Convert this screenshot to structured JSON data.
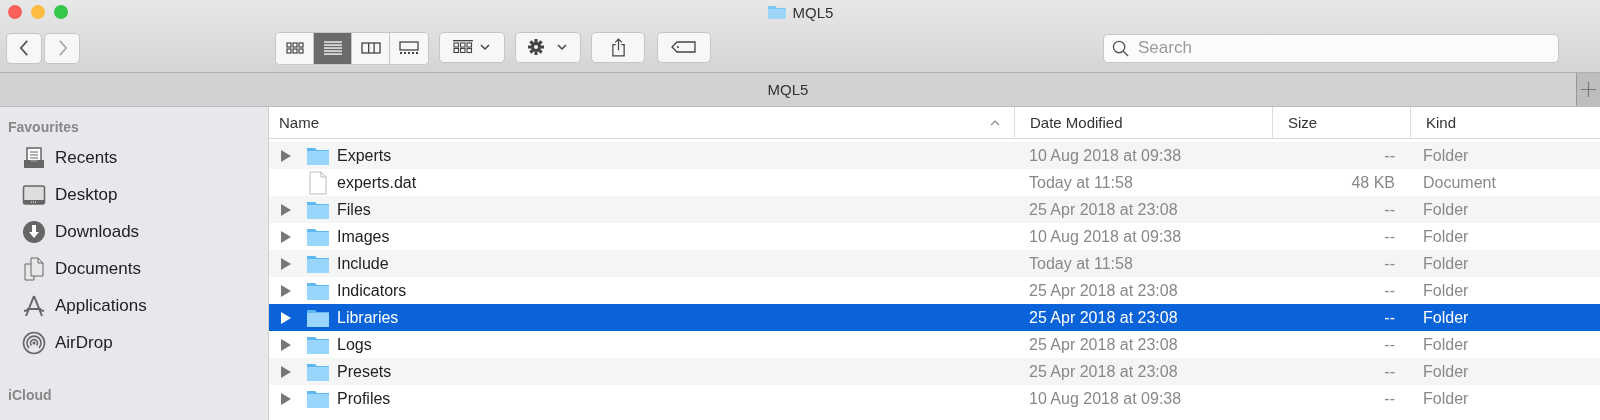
{
  "window": {
    "title": "MQL5"
  },
  "toolbar": {
    "view_modes": [
      {
        "kind": "icons",
        "selected": false
      },
      {
        "kind": "list",
        "selected": true
      },
      {
        "kind": "columns",
        "selected": false
      },
      {
        "kind": "gallery",
        "selected": false
      }
    ],
    "search": {
      "placeholder": "Search"
    }
  },
  "tab_bar": {
    "tabs": [
      {
        "label": "MQL5",
        "selected": true
      }
    ]
  },
  "sidebar": {
    "sections": [
      {
        "title": "Favourites",
        "items": [
          {
            "kind": "recents",
            "label": "Recents"
          },
          {
            "kind": "desktop",
            "label": "Desktop"
          },
          {
            "kind": "downloads",
            "label": "Downloads"
          },
          {
            "kind": "documents",
            "label": "Documents"
          },
          {
            "kind": "applications",
            "label": "Applications"
          },
          {
            "kind": "airdrop",
            "label": "AirDrop"
          }
        ]
      },
      {
        "title": "iCloud"
      }
    ]
  },
  "table": {
    "columns": [
      "Name",
      "Date Modified",
      "Size",
      "Kind"
    ],
    "rows": [
      {
        "kind": "folder",
        "name": "Experts",
        "date": "10 Aug 2018 at 09:38",
        "size": "--",
        "type": "Folder",
        "selected": false
      },
      {
        "kind": "file",
        "name": "experts.dat",
        "date": "Today at 11:58",
        "size": "48 KB",
        "type": "Document",
        "selected": false
      },
      {
        "kind": "folder",
        "name": "Files",
        "date": "25 Apr 2018 at 23:08",
        "size": "--",
        "type": "Folder",
        "selected": false
      },
      {
        "kind": "folder",
        "name": "Images",
        "date": "10 Aug 2018 at 09:38",
        "size": "--",
        "type": "Folder",
        "selected": false
      },
      {
        "kind": "folder",
        "name": "Include",
        "date": "Today at 11:58",
        "size": "--",
        "type": "Folder",
        "selected": false
      },
      {
        "kind": "folder",
        "name": "Indicators",
        "date": "25 Apr 2018 at 23:08",
        "size": "--",
        "type": "Folder",
        "selected": false
      },
      {
        "kind": "folder",
        "name": "Libraries",
        "date": "25 Apr 2018 at 23:08",
        "size": "--",
        "type": "Folder",
        "selected": true
      },
      {
        "kind": "folder",
        "name": "Logs",
        "date": "25 Apr 2018 at 23:08",
        "size": "--",
        "type": "Folder",
        "selected": false
      },
      {
        "kind": "folder",
        "name": "Presets",
        "date": "25 Apr 2018 at 23:08",
        "size": "--",
        "type": "Folder",
        "selected": false
      },
      {
        "kind": "folder",
        "name": "Profiles",
        "date": "10 Aug 2018 at 09:38",
        "size": "--",
        "type": "Folder",
        "selected": false
      }
    ]
  }
}
